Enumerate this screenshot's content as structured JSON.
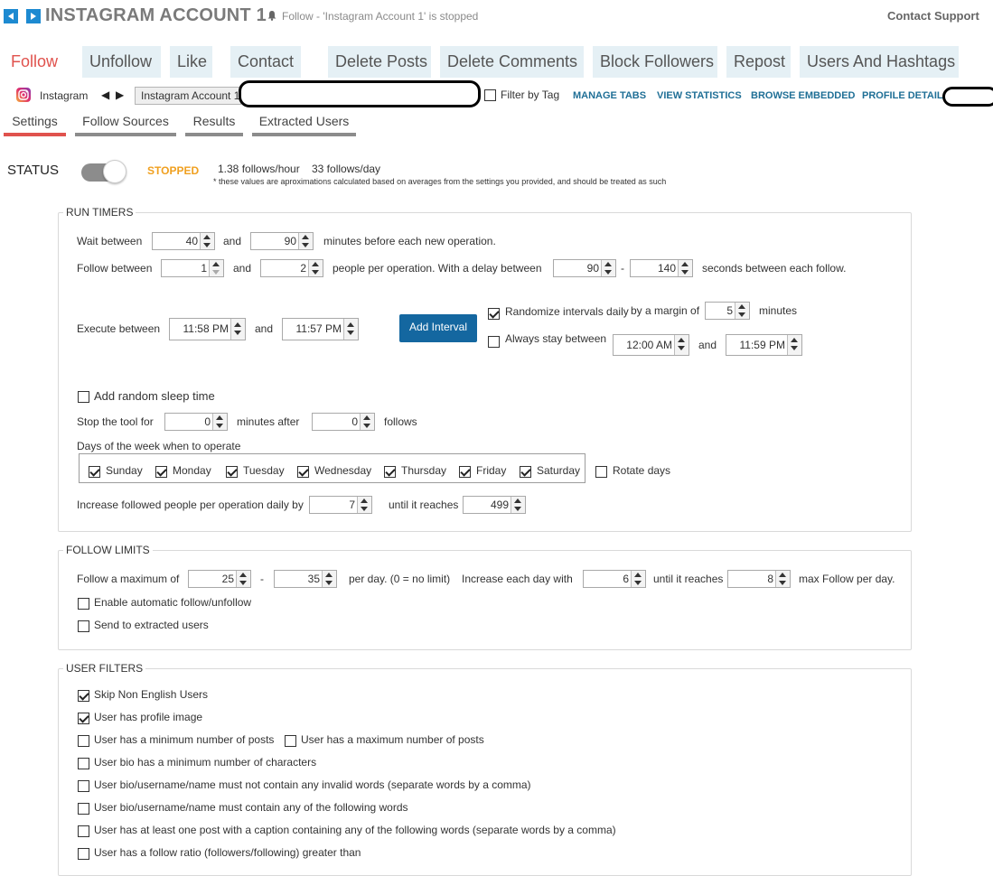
{
  "header": {
    "title": "INSTAGRAM ACCOUNT 1",
    "status": "Follow - 'Instagram Account 1' is stopped",
    "contact_support": "Contact Support"
  },
  "main_tabs": [
    "Follow",
    "Unfollow",
    "Like",
    "Contact",
    "Delete Posts",
    "Delete Comments",
    "Block Followers",
    "Repost",
    "Users And Hashtags"
  ],
  "toolbar": {
    "network": "Instagram",
    "account": "Instagram Account 1",
    "filter_by_tag": "Filter by Tag",
    "links": [
      "MANAGE TABS",
      "VIEW STATISTICS",
      "BROWSE EMBEDDED",
      "PROFILE DETAILS"
    ]
  },
  "sub_tabs": [
    "Settings",
    "Follow Sources",
    "Results",
    "Extracted Users"
  ],
  "status": {
    "label": "STATUS",
    "state": "STOPPED",
    "rate_hour": "1.38 follows/hour",
    "rate_day": "33 follows/day",
    "note": "* these values are aproximations calculated based on averages from the settings you provided, and should be treated as such"
  },
  "run_timers": {
    "legend": "RUN TIMERS",
    "wait_between": "Wait between",
    "wait_min": "40",
    "and": "and",
    "wait_max": "90",
    "wait_suffix": "minutes before each new operation.",
    "follow_between": "Follow between",
    "follow_min": "1",
    "follow_max": "2",
    "follow_suffix": "people per operation.  With a delay between",
    "delay_min": "90",
    "dash": "-",
    "delay_max": "140",
    "delay_suffix": "seconds between each follow.",
    "execute_between": "Execute between",
    "exec_start": "11:58 PM",
    "exec_end": "11:57 PM",
    "add_interval": "Add Interval",
    "randomize": "Randomize intervals daily",
    "by_margin": "by a margin of",
    "margin": "5",
    "minutes": "minutes",
    "always_stay": "Always stay between",
    "stay_start": "12:00 AM",
    "stay_end": "11:59 PM",
    "random_sleep": "Add random sleep time",
    "stop_tool": "Stop the tool for",
    "stop_minutes": "0",
    "minutes_after": "minutes after",
    "stop_follows": "0",
    "follows": "follows",
    "days_label": "Days of the week when to operate",
    "days": [
      "Sunday",
      "Monday",
      "Tuesday",
      "Wednesday",
      "Thursday",
      "Friday",
      "Saturday"
    ],
    "rotate_days": "Rotate days",
    "increase_label": "Increase followed people per operation daily by",
    "increase_by": "7",
    "until_reaches": "until it reaches",
    "increase_max": "499"
  },
  "follow_limits": {
    "legend": "FOLLOW LIMITS",
    "follow_max": "Follow a maximum of",
    "max_min": "25",
    "max_max": "35",
    "per_day": "per day. (0 = no limit)",
    "increase_each": "Increase each day with",
    "increase_val": "6",
    "until_reaches": "until it reaches",
    "until_val": "8",
    "max_follow": "max Follow per day.",
    "auto_follow": "Enable automatic follow/unfollow",
    "send_extracted": "Send to extracted users"
  },
  "user_filters": {
    "legend": "USER FILTERS",
    "items": [
      "Skip Non English Users",
      "User has profile image",
      "User has a minimum number of posts",
      "User has a maximum number of posts",
      "User bio has a minimum number of characters",
      "User bio/username/name must not contain any invalid words (separate words by a comma)",
      "User bio/username/name must contain any of the following words",
      "User has at least one post with a caption containing any of the following words (separate words by a comma)",
      "User has a follow ratio (followers/following) greater than"
    ]
  },
  "colors": {
    "accent": "#e0524d",
    "link": "#1f6f96",
    "tab_bg": "#e5f0f5",
    "button": "#1467a0",
    "stopped": "#f0a020"
  }
}
